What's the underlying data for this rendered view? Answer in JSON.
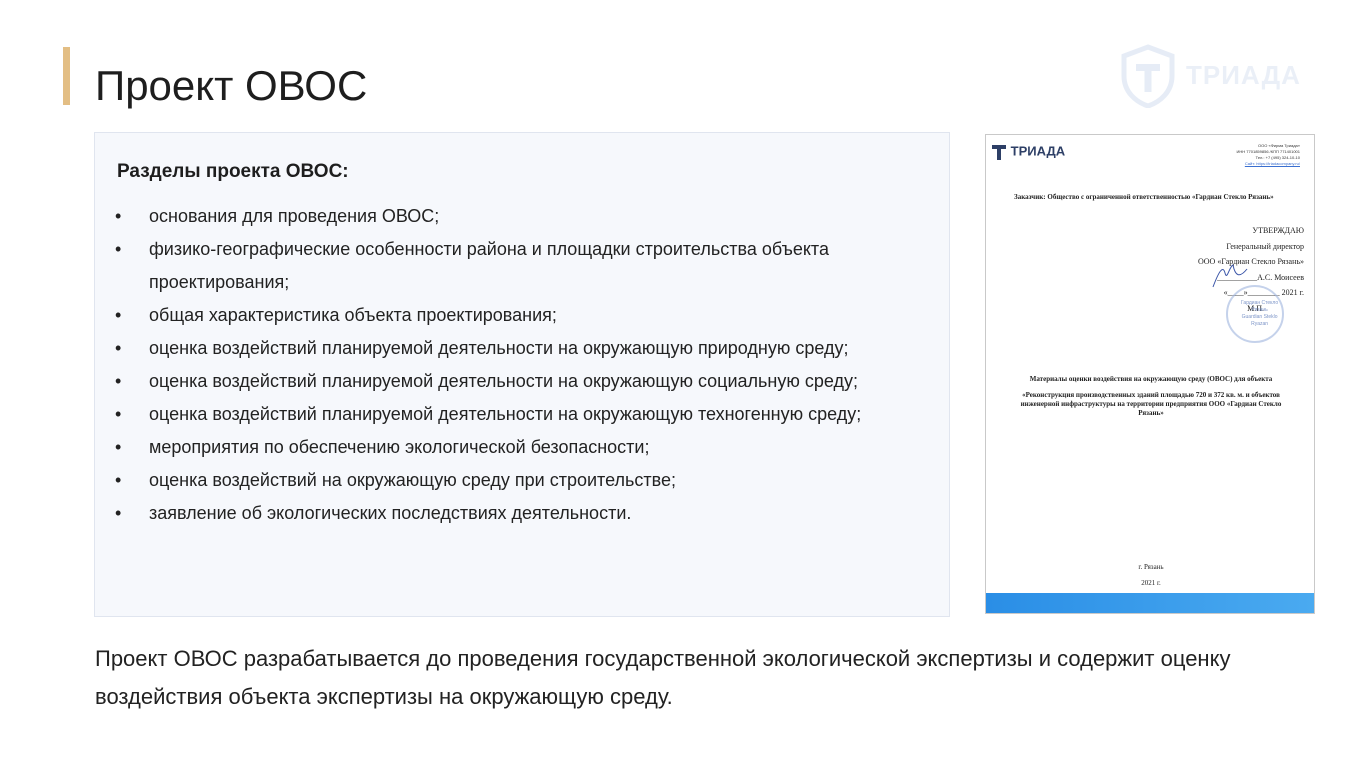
{
  "page": {
    "title": "Проект ОВОС",
    "accent_color": "#e3be84",
    "watermark": {
      "icon": "shield-t-logo-icon",
      "text": "ТРИАДА"
    }
  },
  "panel": {
    "heading": "Разделы проекта ОВОС:",
    "items": [
      "основания для проведения ОВОС;",
      "физико-географические особенности района и площадки строительства объекта проектирования;",
      "общая характеристика объекта проектирования;",
      "оценка воздействий планируемой деятельности на окружающую природную среду;",
      "оценка воздействий планируемой деятельности на окружающую социальную среду;",
      "оценка воздействий планируемой деятельности на окружающую техногенную среду;",
      "мероприятия по обеспечению экологической безопасности;",
      "оценка воздействий на окружающую среду при строительстве;",
      "заявление об экологических последствиях деятельности."
    ]
  },
  "document": {
    "logo_text": "ТРИАДА",
    "contacts": [
      "ООО «Фирма Триада»",
      "ИНН 7701859856 /КПП 771401001",
      "Тел.: +7 (495) 324-10-10",
      "Сайт: https://triadacompany.ru/"
    ],
    "customer": "Заказчик: Общество с ограниченной ответственностью «Гардиан Стекло Рязань»",
    "approve": [
      "УТВЕРЖДАЮ",
      "Генеральный директор",
      "ООО «Гардиан Стекло Рязань»",
      "__________А.С. Моисеев",
      "«____»________ 2021 г.",
      "М.П."
    ],
    "stamp_text": [
      "Гардиан Стекло",
      "Рязань",
      "Guardian Steklo",
      "Ryazan"
    ],
    "materials_title": "Материалы оценки воздействия на окружающую среду (ОВОС) для объекта",
    "materials_object": "«Реконструкция производственных зданий площадью 720 и 372 кв. м. и объектов инженерной инфраструктуры на территории предприятия ООО «Гардиан Стекло Рязань»",
    "city": "г. Рязань",
    "year": "2021 г."
  },
  "summary": "Проект ОВОС разрабатывается до проведения государственной экологической экспертизы и содержит оценку воздействия объекта экспертизы на окружающую среду."
}
